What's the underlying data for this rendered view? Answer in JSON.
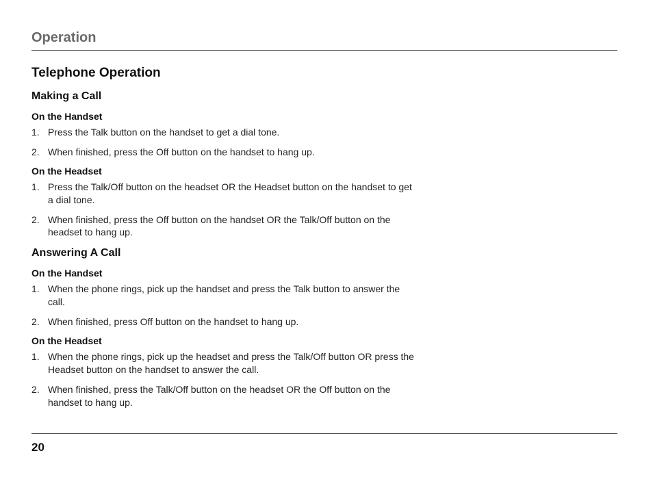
{
  "header": "Operation",
  "section": "Telephone Operation",
  "makingCall": {
    "title": "Making a Call",
    "handset": {
      "title": "On the Handset",
      "steps": [
        "Press the Talk button on the handset to get a dial tone.",
        "When finished, press the Off button on the handset to hang up."
      ]
    },
    "headset": {
      "title": "On the Headset",
      "steps": [
        "Press the Talk/Off button on the headset OR the Headset button on the handset to get a dial tone.",
        "When finished, press the Off button on the handset OR the Talk/Off button on the headset to hang up."
      ]
    }
  },
  "answeringCall": {
    "title": "Answering A Call",
    "handset": {
      "title": "On the Handset",
      "steps": [
        "When the phone rings, pick up the handset and press the Talk button to answer the call.",
        "When finished, press Off button on the handset to hang up."
      ]
    },
    "headset": {
      "title": "On the Headset",
      "steps": [
        "When the phone rings, pick up the headset and press the Talk/Off button OR press the Headset button on the handset to answer the call.",
        "When finished, press the Talk/Off button on the headset OR the Off button on the handset to hang up."
      ]
    }
  },
  "pageNumber": "20"
}
